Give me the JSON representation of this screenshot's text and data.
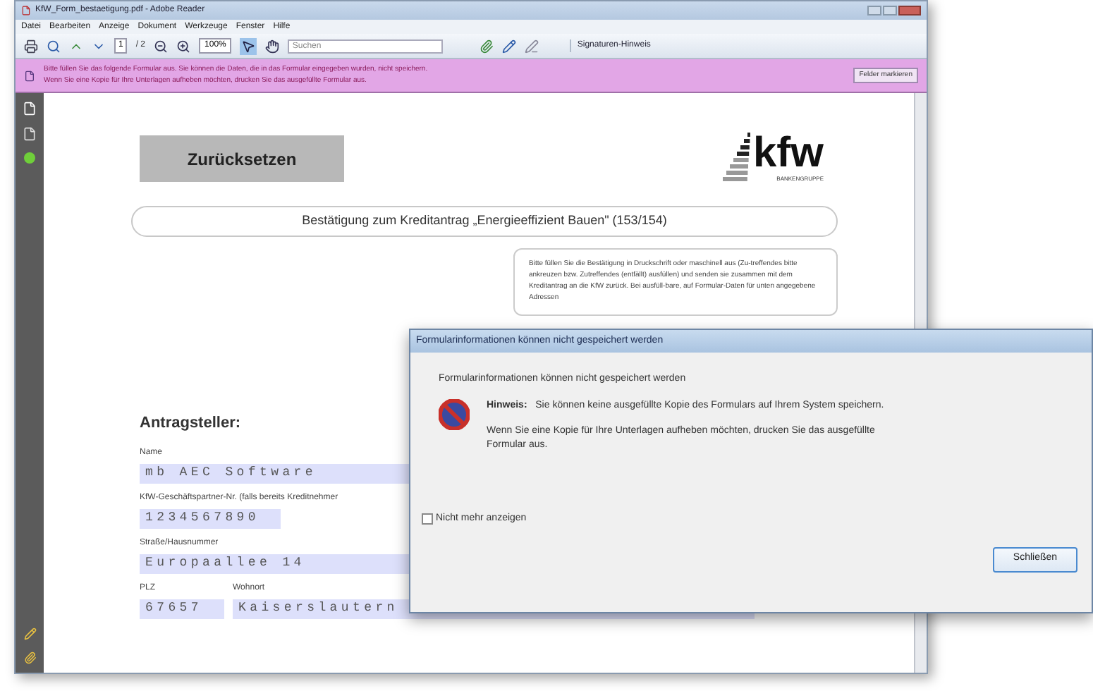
{
  "window": {
    "title": "KfW_Form_bestaetigung.pdf - Adobe Reader"
  },
  "menu": [
    "Datei",
    "Bearbeiten",
    "Anzeige",
    "Dokument",
    "Werkzeuge",
    "Fenster",
    "Hilfe"
  ],
  "toolbar": {
    "page": "1",
    "page_count": "/ 2",
    "zoom": "100%",
    "find_placeholder": "Suchen",
    "hint_button": "Signaturen-Hinweis"
  },
  "form_bar": {
    "lines": [
      "Bitte füllen Sie das folgende Formular aus. Sie können die Daten, die in das Formular eingegeben wurden, nicht speichern.",
      "Wenn Sie eine Kopie für Ihre Unterlagen aufheben möchten, drucken Sie das ausgefüllte Formular aus."
    ],
    "highlight_button": "Felder markieren"
  },
  "document": {
    "reset_button": "Zurücksetzen",
    "logo": {
      "text": "kfw",
      "subtext": "BANKENGRUPPE"
    },
    "heading": "Bestätigung zum Kreditantrag „Energieeffizient Bauen\" (153/154)",
    "info_text": "Bitte füllen Sie die Bestätigung in Druckschrift oder maschinell aus (Zu-treffendes bitte ankreuzen bzw. Zutreffendes (entfällt) ausfüllen) und senden sie zusammen mit dem Kreditantrag an die KfW zurück. Bei ausfüll-bare, auf Formular-Daten für unten angegebene Adressen",
    "section": "Antragsteller:",
    "fields": [
      {
        "label": "Name",
        "value": "mb AEC Software"
      },
      {
        "label": "KfW-Geschäftspartner-Nr. (falls bereits Kreditnehmer",
        "value": "1234567890"
      },
      {
        "label": "Straße/Hausnummer",
        "value": "Europaallee 14"
      }
    ],
    "address": [
      {
        "label": "PLZ",
        "value": "67657"
      },
      {
        "label": "Wohnort",
        "value": "Kaiserslautern"
      }
    ]
  },
  "dialog": {
    "title": "Formularinformationen können nicht gespeichert werden",
    "message": "Formularinformationen können nicht gespeichert werden",
    "note": "**Hinweis:**   Sie können keine ausgefüllte Kopie des Formulars auf Ihrem System speichern.",
    "advice": "Wenn Sie eine Kopie für Ihre Unterlagen aufheben möchten, drucken Sie das ausgefüllte Formular aus.",
    "checkbox": {
      "label": "Nicht mehr anzeigen",
      "checked": false
    },
    "button": "Schließen"
  }
}
